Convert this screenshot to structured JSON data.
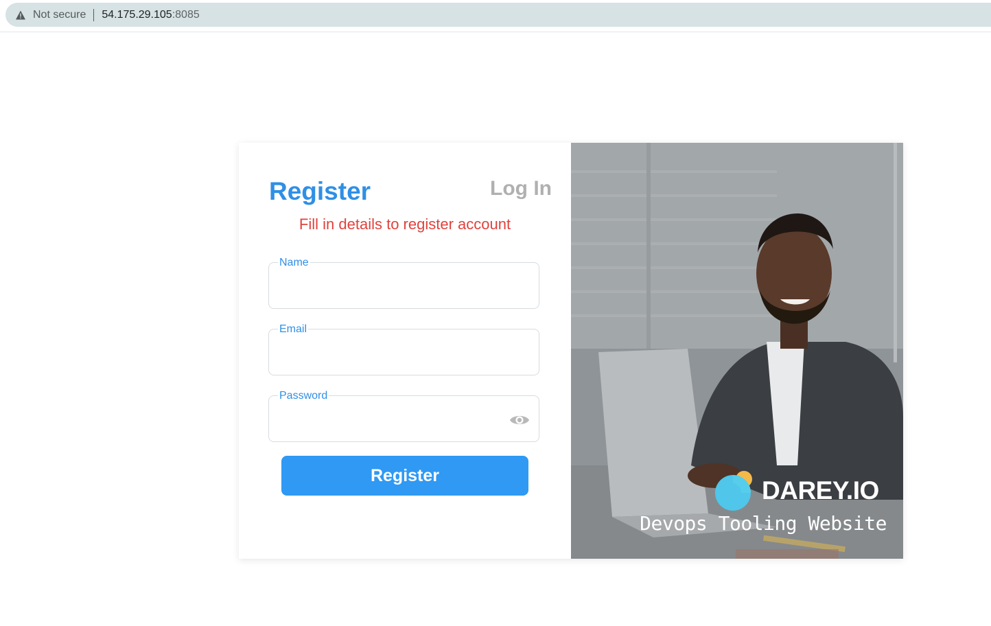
{
  "browser": {
    "security_label": "Not secure",
    "url_host": "54.175.29.105",
    "url_port": ":8085"
  },
  "form": {
    "register_tab": "Register",
    "login_tab": "Log In",
    "subtitle": "Fill in details to register account",
    "fields": [
      {
        "label": "Name",
        "value": ""
      },
      {
        "label": "Email",
        "value": ""
      },
      {
        "label": "Password",
        "value": ""
      }
    ],
    "submit_label": "Register"
  },
  "brand": {
    "logo_text": "DAREY.IO",
    "tagline": "Devops Tooling Website"
  },
  "colors": {
    "accent": "#2f99f3",
    "subtitle": "#e0423c",
    "inactive_tab": "#b0b0b0"
  },
  "icons": {
    "security": "warning-triangle-icon",
    "password_toggle": "eye-icon",
    "logo": "darey-logo-icon"
  }
}
